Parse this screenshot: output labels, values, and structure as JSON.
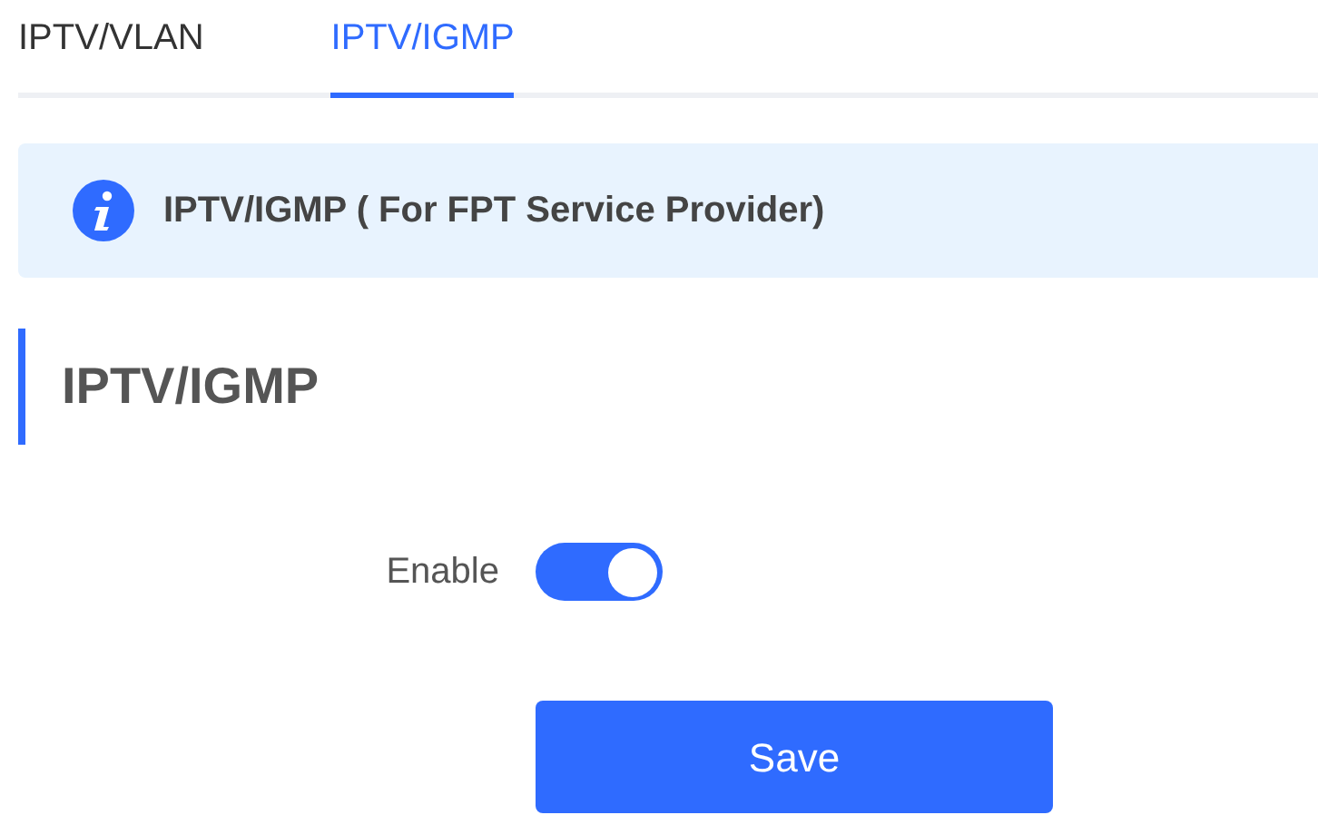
{
  "tabs": [
    {
      "label": "IPTV/VLAN",
      "selected": false
    },
    {
      "label": "IPTV/IGMP",
      "selected": true
    }
  ],
  "notice": {
    "text": "IPTV/IGMP ( For FPT Service Provider)"
  },
  "section": {
    "title": "IPTV/IGMP"
  },
  "enable": {
    "label": "Enable",
    "on": true
  },
  "buttons": [
    "Save"
  ]
}
